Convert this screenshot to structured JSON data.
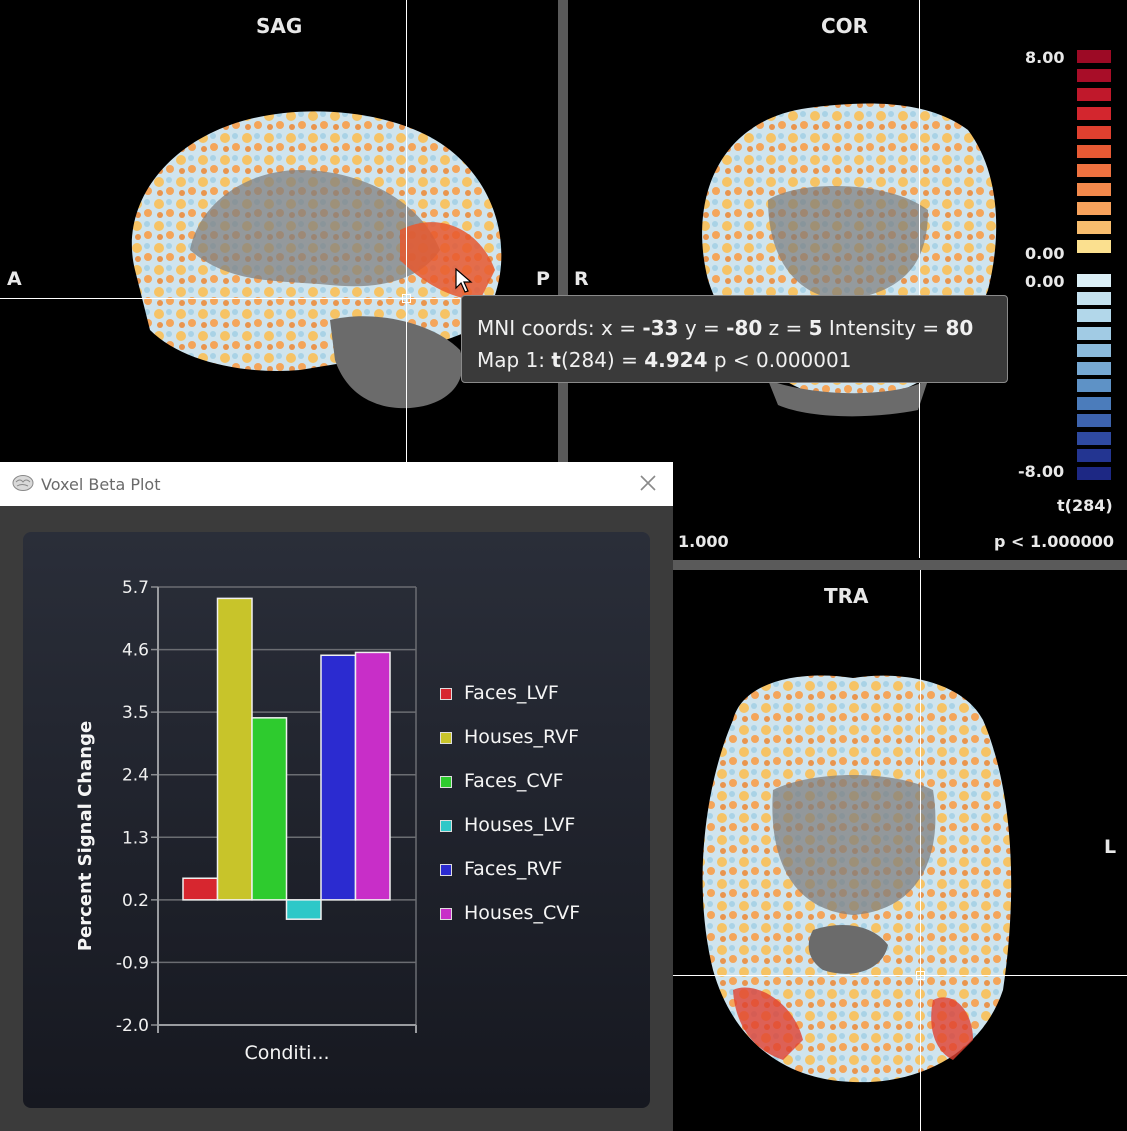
{
  "views": {
    "sag": {
      "title": "SAG",
      "left": "A",
      "right": "P"
    },
    "cor": {
      "title": "COR",
      "left": "R",
      "thr_left": "1.000",
      "thr_right": "p < 1.000000"
    },
    "tra": {
      "title": "TRA",
      "right": "L"
    }
  },
  "tooltip": {
    "line1_a": "MNI coords: x = ",
    "x": "-33",
    "line1_b": " y = ",
    "y": "-80",
    "line1_c": " z = ",
    "z": "5",
    "line1_d": "  Intensity = ",
    "intensity": "80",
    "line2_a": "Map 1: ",
    "stat": "t",
    "line2_b": "(284) = ",
    "tval": "4.924",
    "line2_c": "  p < 0.000001"
  },
  "colorbar": {
    "max": "8.00",
    "pos_zero": "0.00",
    "neg_zero": "0.00",
    "min": "-8.00",
    "stat_label": "t(284)",
    "positive_colors": [
      "#9c0a25",
      "#a80d28",
      "#c0182b",
      "#d3262e",
      "#e0402f",
      "#e85a34",
      "#ef7240",
      "#f3894c",
      "#f7a25c",
      "#f8bd6e",
      "#fbe08f"
    ],
    "negative_colors": [
      "#dbeff7",
      "#c4e1ee",
      "#b2d7ea",
      "#a1cbe4",
      "#8cbbdc",
      "#77a9d3",
      "#5e92c6",
      "#4b7cbb",
      "#3d63ad",
      "#2f4aa0",
      "#233591",
      "#1d2884"
    ]
  },
  "window": {
    "title": "Voxel Beta Plot",
    "close_icon": "close-icon",
    "app_icon": "brain-icon"
  },
  "chart_data": {
    "type": "bar",
    "ylabel": "Percent Signal Change",
    "xlabel": "Conditi...",
    "ylim": [
      -2.0,
      5.7
    ],
    "yticks": [
      "5.7",
      "4.6",
      "3.5",
      "2.4",
      "1.3",
      "0.2",
      "-0.9",
      "-2.0"
    ],
    "grid": true,
    "legend_position": "right",
    "series": [
      {
        "name": "Faces_LVF",
        "value": 0.58,
        "color": "#d7262f"
      },
      {
        "name": "Houses_RVF",
        "value": 5.5,
        "color": "#c8c42a"
      },
      {
        "name": "Faces_CVF",
        "value": 3.4,
        "color": "#2ecb2e"
      },
      {
        "name": "Houses_LVF",
        "value": -0.14,
        "color": "#2ec8c8"
      },
      {
        "name": "Faces_RVF",
        "value": 4.5,
        "color": "#2b2bd0"
      },
      {
        "name": "Houses_CVF",
        "value": 4.55,
        "color": "#c82ec8"
      }
    ]
  }
}
